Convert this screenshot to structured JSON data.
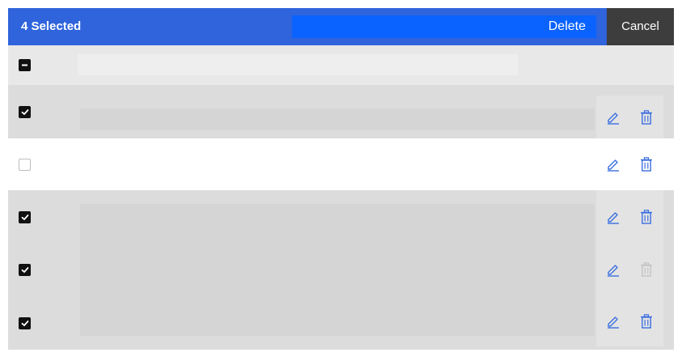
{
  "selection_bar": {
    "count_label": "4 Selected",
    "delete_label": "Delete",
    "cancel_label": "Cancel"
  },
  "header": {
    "select_all_state": "indeterminate"
  },
  "rows": [
    {
      "selected": true,
      "delete_enabled": true
    },
    {
      "selected": false,
      "delete_enabled": true
    },
    {
      "selected": true,
      "delete_enabled": true
    },
    {
      "selected": true,
      "delete_enabled": false
    },
    {
      "selected": true,
      "delete_enabled": true
    }
  ],
  "colors": {
    "selection_bar": "#2f64dc",
    "delete_button": "#0a62ff",
    "cancel_button": "#3d3d3d",
    "action_icon": "#3c6fe0",
    "disabled_icon": "#c4c4c4",
    "selected_row": "#dcdcdc"
  },
  "icons": {
    "edit": "pencil-icon",
    "delete": "trash-icon",
    "checked": "checkmark-icon",
    "indeterminate": "minus-icon"
  }
}
